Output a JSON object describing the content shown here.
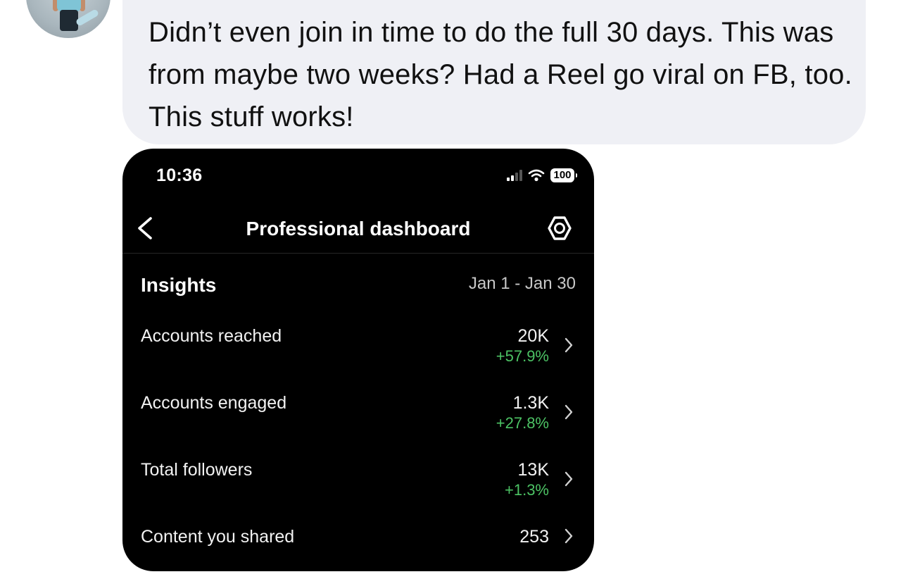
{
  "message": {
    "text": "Didn’t even join in time to do the full 30 days. This was from maybe two weeks? Had a Reel go viral on FB, too. This stuff works!"
  },
  "screenshot": {
    "status_bar": {
      "time": "10:36",
      "battery": "100"
    },
    "header": {
      "title": "Professional dashboard"
    },
    "insights": {
      "title": "Insights",
      "date_range": "Jan 1 - Jan 30",
      "rows": [
        {
          "label": "Accounts reached",
          "value": "20K",
          "change": "+57.9%"
        },
        {
          "label": "Accounts engaged",
          "value": "1.3K",
          "change": "+27.8%"
        },
        {
          "label": "Total followers",
          "value": "13K",
          "change": "+1.3%"
        },
        {
          "label": "Content you shared",
          "value": "253",
          "change": ""
        }
      ]
    }
  },
  "colors": {
    "bubble": "#eff0f5",
    "screenshot_bg": "#000000",
    "positive_change": "#4cc264"
  },
  "icons": [
    "avatar",
    "signal-icon",
    "wifi-icon",
    "battery-icon",
    "back-arrow-icon",
    "settings-gear-icon",
    "chevron-right-icon"
  ]
}
